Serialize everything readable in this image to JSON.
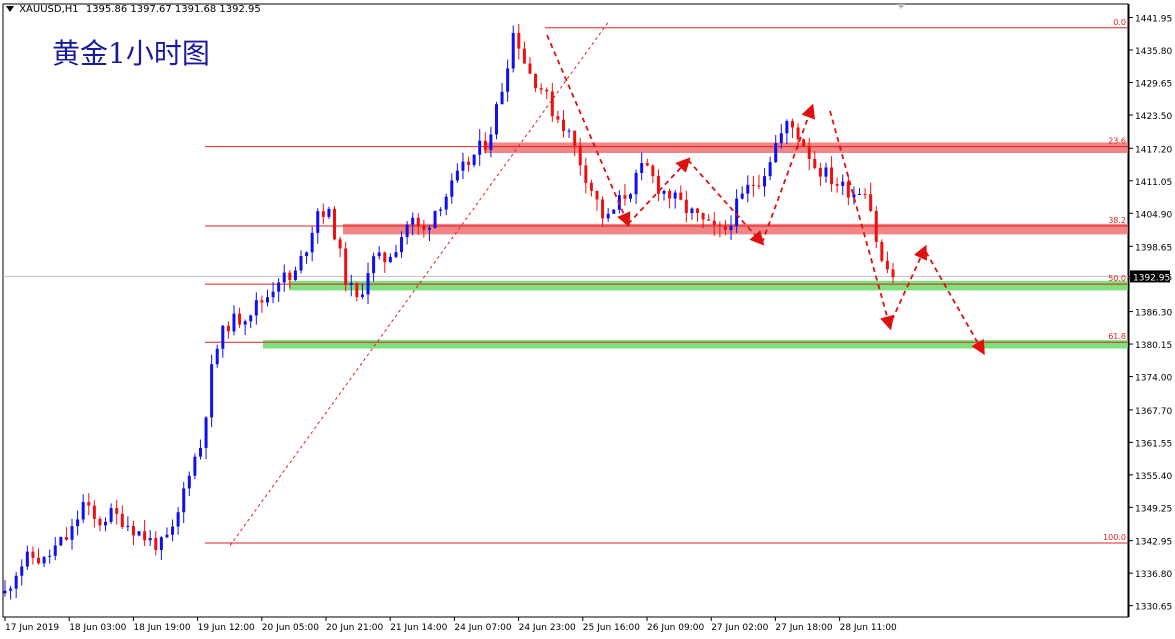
{
  "header": {
    "symbol": "XAUUSD,H1",
    "ohlc": "1395.86 1397.67 1391.68 1392.95",
    "chart_title": "黄金1小时图"
  },
  "colors": {
    "bull": "#1010ee",
    "bear": "#ee1010",
    "fib_line": "#e02020",
    "resistance_zone": "#f07070",
    "support_zone": "#66dd66",
    "arrow": "#e01010",
    "grid": "#c8c8c8"
  },
  "chart_data": {
    "type": "candlestick",
    "title": "黄金1小时图",
    "ylim": [
      1328.5,
      1444.5
    ],
    "current_price": "1392.95",
    "y_ticks": [
      "1441.95",
      "1435.80",
      "1429.65",
      "1423.50",
      "1417.20",
      "1411.05",
      "1404.90",
      "1398.65",
      "1392.95",
      "1386.30",
      "1380.15",
      "1374.00",
      "1367.70",
      "1361.55",
      "1355.40",
      "1349.25",
      "1342.95",
      "1336.80",
      "1330.65"
    ],
    "x_ticks": [
      "17 Jun 2019",
      "18 Jun 03:00",
      "18 Jun 19:00",
      "19 Jun 12:00",
      "20 Jun 05:00",
      "20 Jun 21:00",
      "21 Jun 14:00",
      "24 Jun 07:00",
      "24 Jun 23:00",
      "25 Jun 16:00",
      "26 Jun 09:00",
      "27 Jun 02:00",
      "27 Jun 18:00",
      "28 Jun 11:00"
    ],
    "fibonacci": [
      {
        "level": "0.0",
        "price": 1440.0
      },
      {
        "level": "23.6",
        "price": 1417.5
      },
      {
        "level": "38.2",
        "price": 1402.5
      },
      {
        "level": "50.0",
        "price": 1391.5
      },
      {
        "level": "61.8",
        "price": 1380.5
      },
      {
        "level": "100.0",
        "price": 1342.5
      }
    ],
    "zones": [
      {
        "role": "resistance",
        "low": 1416.3,
        "high": 1418.3
      },
      {
        "role": "resistance",
        "low": 1400.9,
        "high": 1402.9
      },
      {
        "role": "support",
        "low": 1390.3,
        "high": 1392.1
      },
      {
        "role": "support",
        "low": 1379.3,
        "high": 1380.9
      }
    ],
    "key_prices": [
      1333,
      1338,
      1340,
      1339,
      1342,
      1344,
      1350,
      1346,
      1348,
      1347,
      1345,
      1343,
      1342,
      1345,
      1356,
      1361,
      1378,
      1384,
      1385,
      1387,
      1389,
      1393,
      1392,
      1398,
      1406,
      1404,
      1393,
      1388,
      1396,
      1396,
      1399,
      1404,
      1401,
      1406,
      1409,
      1413,
      1416,
      1419,
      1428,
      1440,
      1432,
      1429,
      1424,
      1421,
      1415,
      1409,
      1403,
      1407,
      1410,
      1414,
      1410,
      1408,
      1406,
      1404,
      1402,
      1401,
      1406,
      1410,
      1412,
      1418,
      1422,
      1419,
      1414,
      1412,
      1410,
      1409,
      1410,
      1396,
      1392.95
    ],
    "projection": [
      [
        0,
        1400
      ],
      [
        6,
        1384
      ],
      [
        11,
        1398
      ],
      [
        28,
        1380
      ]
    ]
  }
}
